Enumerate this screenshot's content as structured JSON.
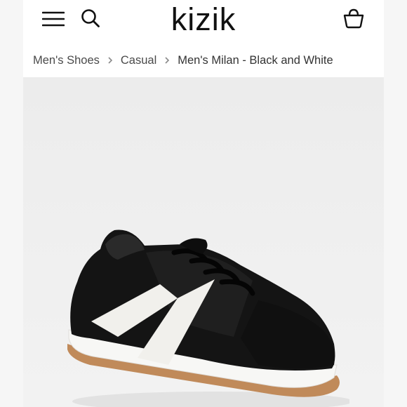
{
  "header": {
    "logo": "kizik",
    "icons": {
      "menu": "hamburger-menu-icon",
      "search": "search-icon",
      "cart": "shopping-basket-icon"
    }
  },
  "breadcrumb": {
    "items": [
      "Men's Shoes",
      "Casual"
    ],
    "current": "Men's Milan - Black and White"
  },
  "product": {
    "image_alt": "Men's Milan - Black and White sneaker"
  },
  "colors": {
    "text": "#111111",
    "breadcrumb_text": "#4a4a4a",
    "background": "#f6f6f6",
    "image_bg": "#efefef"
  }
}
